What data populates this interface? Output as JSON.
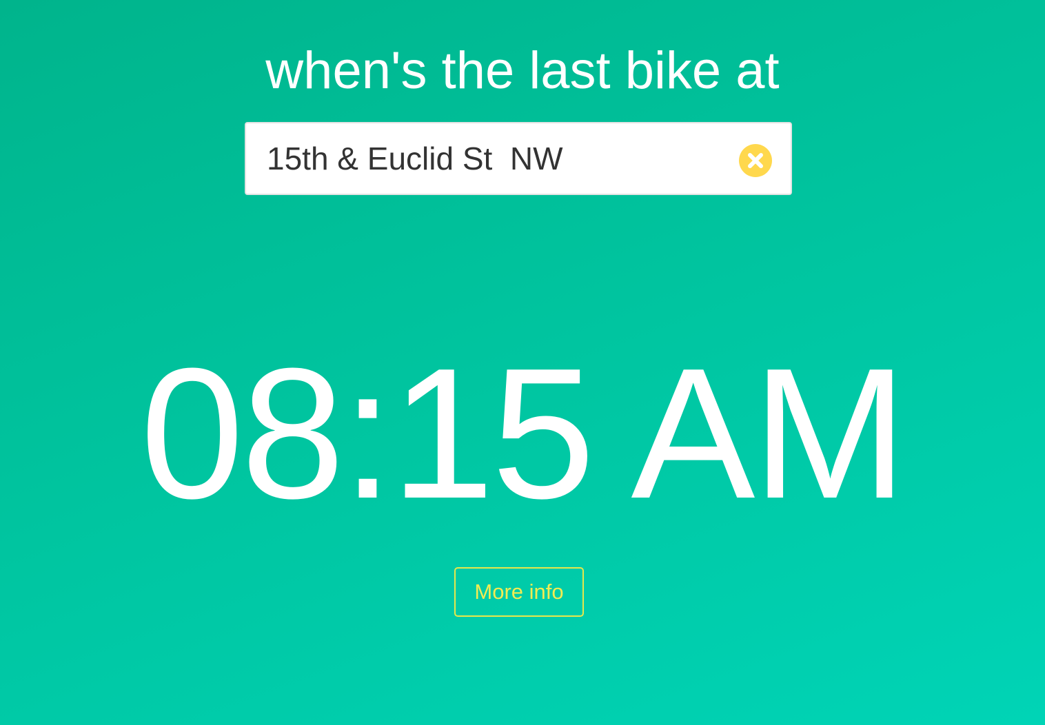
{
  "headline": "when's the last bike at",
  "search": {
    "value": "15th & Euclid St  NW",
    "clear_icon": "close-circle-icon"
  },
  "result": {
    "time": "08:15 AM"
  },
  "more_info_label": "More info",
  "colors": {
    "background_start": "#00b48c",
    "background_end": "#00d4b6",
    "clear_icon": "#ffd84d",
    "more_info": "#f2ec52",
    "text": "#ffffff"
  }
}
